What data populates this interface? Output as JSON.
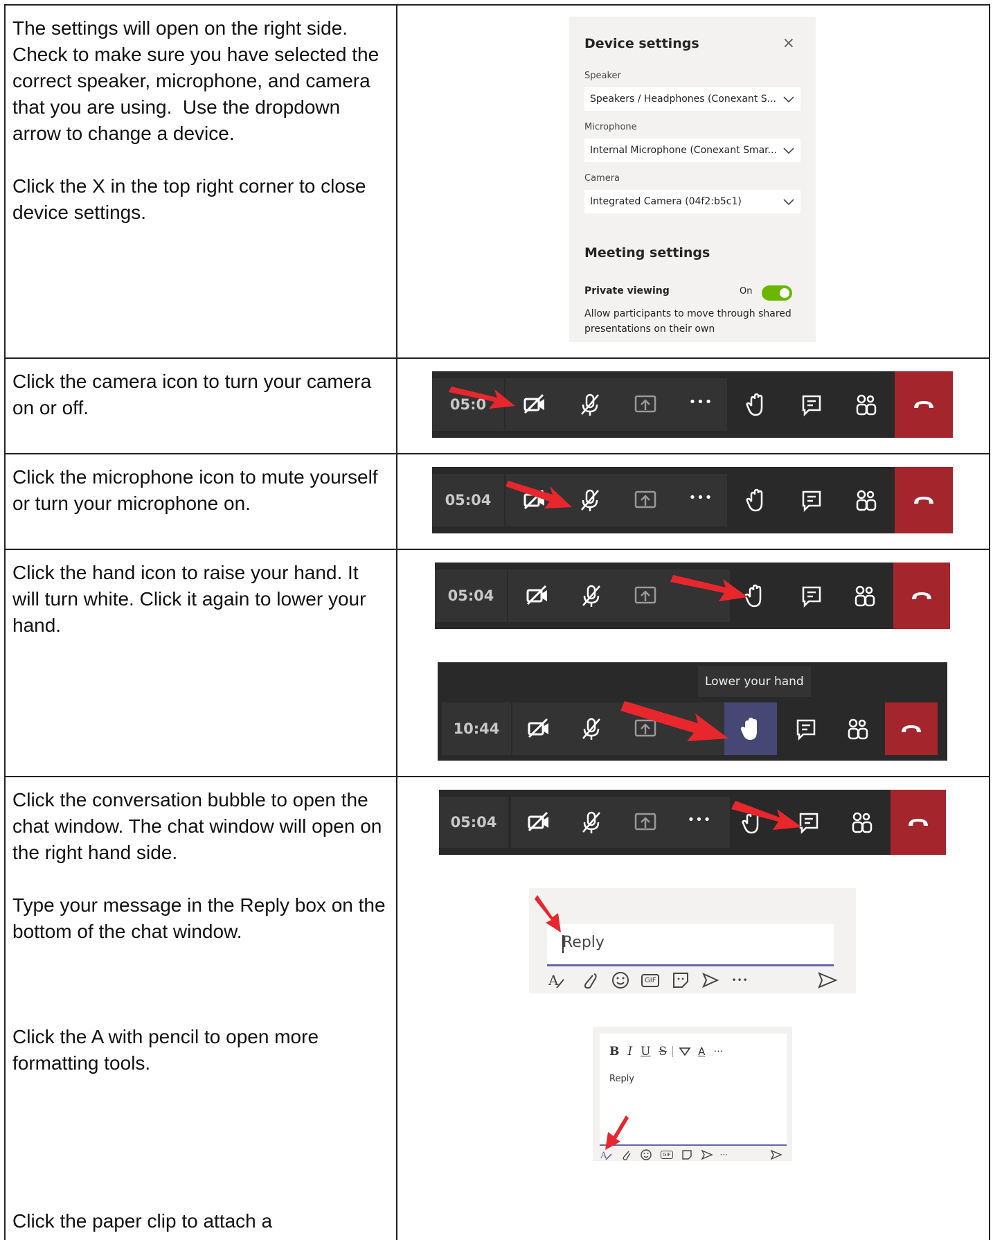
{
  "rows": [
    {
      "instructions": [
        "The settings will open on the right side. Check to make sure you have selected the correct speaker, microphone, and camera that you are using.  Use the dropdown arrow to change a device.",
        "Click the X in the top right corner to close device settings."
      ]
    },
    {
      "instructions": [
        "Click the camera icon to turn your camera on or off."
      ]
    },
    {
      "instructions": [
        "Click the microphone icon to mute yourself or turn your microphone on."
      ]
    },
    {
      "instructions": [
        "Click the hand icon to raise your hand. It will turn white. Click it again to lower your hand."
      ]
    },
    {
      "instructions": [
        "Click the conversation bubble to open the chat window. The chat window will open on the right hand side.",
        "Type your message in the Reply box on the bottom of the chat window.",
        "Click the A with pencil to open more formatting tools.",
        "Click the paper clip to attach a"
      ]
    }
  ],
  "device_settings": {
    "title": "Device settings",
    "close_glyph": "×",
    "speaker_label": "Speaker",
    "speaker_value": "Speakers / Headphones (Conexant S...",
    "microphone_label": "Microphone",
    "microphone_value": "Internal Microphone (Conexant Smar...",
    "camera_label": "Camera",
    "camera_value": "Integrated Camera (04f2:b5c1)",
    "meeting_title": "Meeting settings",
    "private_viewing_label": "Private viewing",
    "toggle_state": "On",
    "private_viewing_desc": "Allow participants to move through shared presentations on their own"
  },
  "toolbars": {
    "camera_timer": "05:0",
    "mic_timer": "05:04",
    "hand_timer": "05:04",
    "lower_hand_timer": "10:44",
    "lower_hand_tooltip": "Lower your hand",
    "chat_timer": "05:04",
    "more_glyph": "•••"
  },
  "reply": {
    "placeholder": "Reply",
    "more_glyph": "•••",
    "gif_label": "GIF"
  },
  "format_tools": {
    "bold": "B",
    "italic": "I",
    "underline": "U",
    "strike": "S",
    "font_color": "A",
    "more": "···",
    "reply_text": "Reply",
    "gif_label": "GIF",
    "more_small": "···"
  },
  "colors": {
    "toolbar_bg": "#292929",
    "hangup": "#a4262c",
    "toggle_on": "#6bb700",
    "accent": "#6264a7",
    "arrow_red": "#e8272d"
  }
}
